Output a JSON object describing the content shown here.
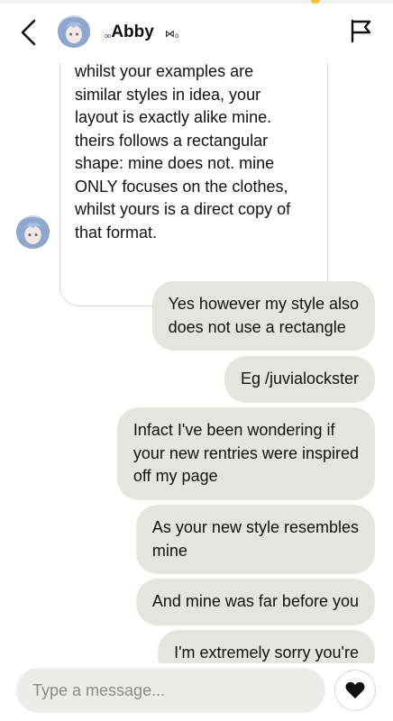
{
  "header": {
    "contact_prefix": "₀₀",
    "contact_name": "Abby",
    "contact_suffix": "⋈₀"
  },
  "messages": {
    "received": [
      {
        "lines": [
          "whilst your examples are",
          "similar styles in idea, your",
          "layout is exactly alike mine.",
          "theirs follows a rectangular",
          "shape: mine does not. mine",
          "ONLY focuses on the clothes,",
          "whilst yours is a direct copy of",
          "that format."
        ]
      }
    ],
    "sent": [
      {
        "lines": [
          "Yes however my style also",
          "does not use a rectangle"
        ]
      },
      {
        "lines": [
          "Eg /juvialockster"
        ]
      },
      {
        "lines": [
          "Infact I've been wondering if",
          "your new rentries were inspired",
          "off my page"
        ]
      },
      {
        "lines": [
          "As your new style resembles",
          "mine"
        ]
      },
      {
        "lines": [
          "And mine was far before you"
        ]
      },
      {
        "lines": [
          "I'm extremely sorry you're"
        ]
      }
    ]
  },
  "composer": {
    "placeholder": "Type a message..."
  },
  "icons": {
    "back": "chevron-left-icon",
    "flag": "flag-icon",
    "heart": "heart-icon",
    "avatar": "anime-avatar"
  },
  "colors": {
    "sent_bubble": "#e5e5df",
    "received_bubble_border": "#d7d7d7",
    "input_bg": "#ececea",
    "accent_dot": "#f2c230"
  }
}
